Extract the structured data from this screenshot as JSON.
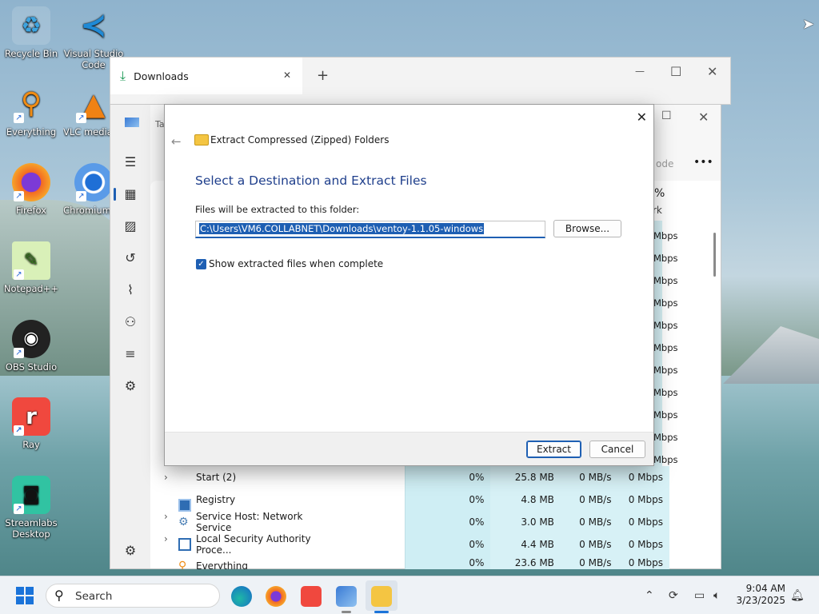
{
  "desktop": {
    "icons": [
      {
        "label": "Recycle Bin"
      },
      {
        "label": "Visual Studio Code"
      },
      {
        "label": "Everything"
      },
      {
        "label": "VLC media player"
      },
      {
        "label": "Firefox"
      },
      {
        "label": "Chromium"
      },
      {
        "label": "Notepad++"
      },
      {
        "label": "OBS Studio"
      },
      {
        "label": "Ray"
      },
      {
        "label": "Streamlabs Desktop"
      }
    ]
  },
  "explorer": {
    "tab_label": "Downloads",
    "tab_close": "✕",
    "new_tab": "+",
    "minimize": "—",
    "maximize": "☐",
    "close": "✕"
  },
  "taskmanager": {
    "title_fragment": "Ta",
    "mode_fragment": "ode",
    "more": "•••",
    "col_fragment_pct": "%",
    "col_fragment_rk": "rk",
    "mbps_col": [
      "Mbps",
      "Mbps",
      "Mbps",
      "Mbps",
      "Mbps",
      "Mbps",
      "Mbps",
      "Mbps",
      "Mbps",
      "Mbps",
      "Mbps"
    ],
    "rows": [
      {
        "name": "Start (2)",
        "expand": true,
        "cpu": "0%",
        "mem": "25.8 MB",
        "disk": "0 MB/s",
        "net": "0 Mbps"
      },
      {
        "name": "Registry",
        "expand": false,
        "cpu": "0%",
        "mem": "4.8 MB",
        "disk": "0 MB/s",
        "net": "0 Mbps"
      },
      {
        "name": "Service Host: Network Service",
        "expand": true,
        "cpu": "0%",
        "mem": "3.0 MB",
        "disk": "0 MB/s",
        "net": "0 Mbps"
      },
      {
        "name": "Local Security Authority Proce...",
        "expand": true,
        "cpu": "0%",
        "mem": "4.4 MB",
        "disk": "0 MB/s",
        "net": "0 Mbps"
      },
      {
        "name": "Everything",
        "expand": false,
        "cpu": "0%",
        "mem": "23.6 MB",
        "disk": "0 MB/s",
        "net": "0 Mbps"
      }
    ],
    "win_maximize": "☐",
    "win_close": "✕"
  },
  "dialog": {
    "title": "Extract Compressed (Zipped) Folders",
    "heading": "Select a Destination and Extract Files",
    "folder_label": "Files will be extracted to this folder:",
    "folder_value": "C:\\Users\\VM6.COLLABNET\\Downloads\\ventoy-1.1.05-windows",
    "browse_label": "Browse...",
    "show_files_label": "Show extracted files when complete",
    "show_files_checked": true,
    "extract_label": "Extract",
    "cancel_label": "Cancel",
    "close": "✕",
    "back": "←"
  },
  "taskbar": {
    "search_label": "Search",
    "time": "9:04 AM",
    "date": "3/23/2025"
  },
  "colors": {
    "accent": "#1e5fb3",
    "heading": "#1f3f8c"
  }
}
